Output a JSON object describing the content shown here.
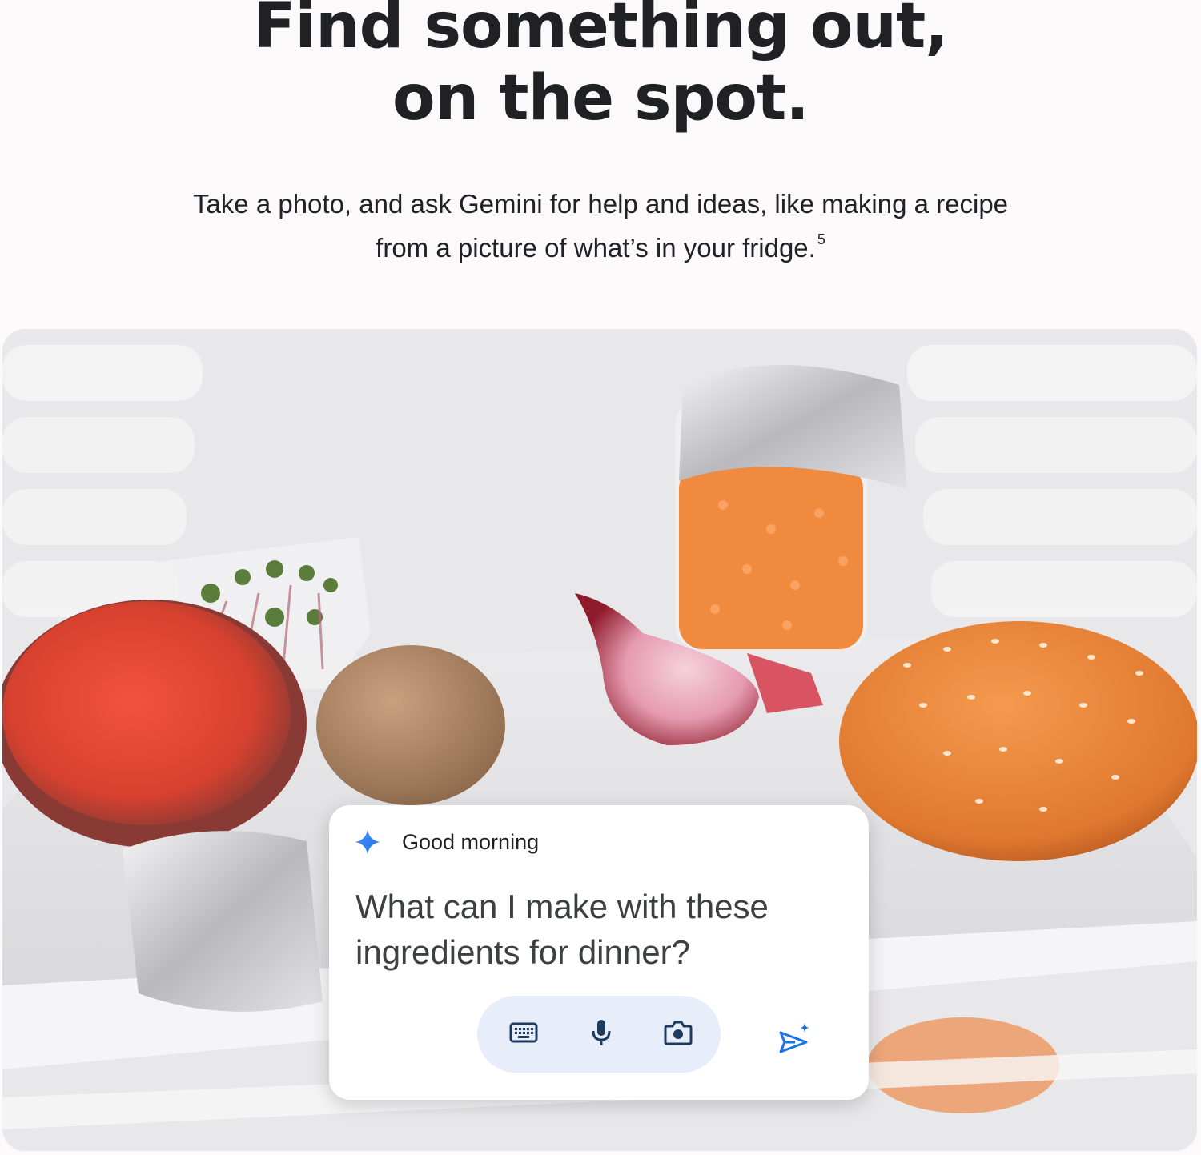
{
  "hero": {
    "title_line1": "Find something out,",
    "title_line2": "on the spot.",
    "subtitle_line1": "Take a photo, and ask Gemini for help and ideas, like making a recipe",
    "subtitle_line2": "from a picture of what’s in your fridge.",
    "footnote": "5"
  },
  "photo": {
    "scene": "fridge-interior"
  },
  "card": {
    "greeting": "Good morning",
    "question_line1": "What can I make with these",
    "question_line2": "ingredients for dinner?",
    "icons": {
      "greeting": "gemini-spark-icon",
      "keyboard": "keyboard-icon",
      "mic": "microphone-icon",
      "camera": "camera-icon",
      "send": "send-sparkle-icon"
    },
    "colors": {
      "accent_blue": "#1a73e8",
      "pill_bg": "#e7eef9",
      "icon_dark": "#1f3a5f"
    }
  }
}
